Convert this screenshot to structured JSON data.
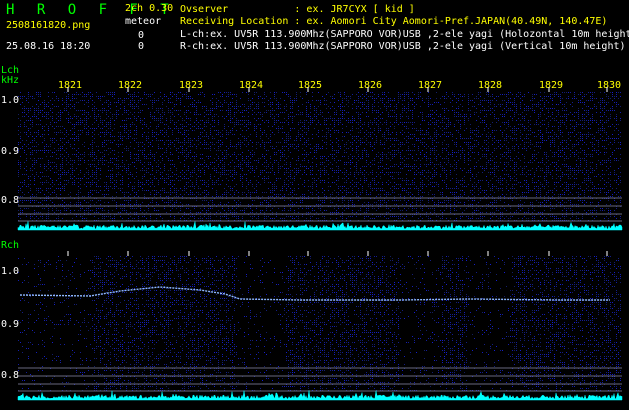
{
  "header": {
    "brand": "H R O F F T",
    "channel_info": "2ch 0.30",
    "meteor_label": "meteor",
    "file_name": "2508161820.png",
    "datetime": "25.08.16 18:20",
    "meteor_count_l": "0",
    "meteor_count_r": "0",
    "observer_line": "Ovserver           : ex. JR7CYX [ kid ]",
    "location_line": "Receiving Location : ex. Aomori City Aomori-Pref.JAPAN(40.49N, 140.47E)",
    "lch_line": "L-ch:ex. UV5R 113.900Mhz(SAPPORO VOR)USB ,2-ele yagi (Holozontal 10m height)",
    "rch_line": "R-ch:ex. UV5R 113.900Mhz(SAPPORO VOR)USB ,2-ele yagi (Vertical 10m height)"
  },
  "labels": {
    "lch": "Lch",
    "khz": "kHz",
    "rch": "Rch"
  },
  "x_axis": {
    "ticks": [
      "1821",
      "1822",
      "1823",
      "1824",
      "1825",
      "1826",
      "1827",
      "1828",
      "1829",
      "1830"
    ]
  },
  "lch_panel": {
    "y_ticks": [
      "1.0",
      "0.9",
      "0.8"
    ]
  },
  "rch_panel": {
    "y_ticks": [
      "1.0",
      "0.9",
      "0.8"
    ]
  },
  "colors": {
    "label": "#00ff00",
    "frequency": "#ffff00",
    "text": "#ffffff",
    "noise_floor": "#00ffff",
    "spectrum": "#1a2aa8",
    "signal_trace": "#8fb8ff"
  }
}
